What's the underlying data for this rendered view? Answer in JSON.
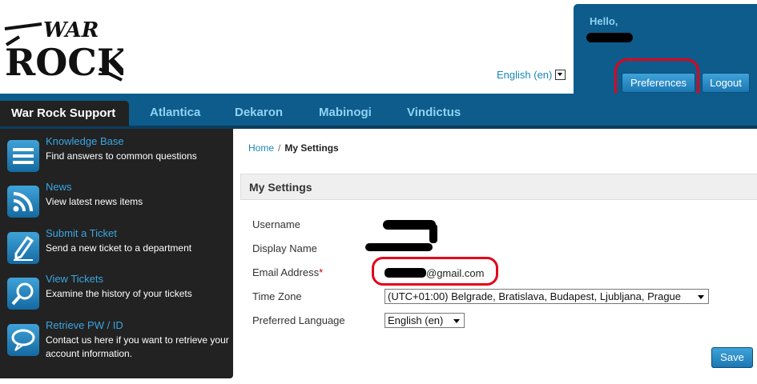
{
  "brand": {
    "logo_text_top": "WAR",
    "logo_text_bottom": "ROCK"
  },
  "header": {
    "language": "English (en)",
    "hello": "Hello,",
    "preferences_label": "Preferences",
    "logout_label": "Logout"
  },
  "nav": {
    "active": "War Rock Support",
    "tabs": [
      "Atlantica",
      "Dekaron",
      "Mabinogi",
      "Vindictus"
    ]
  },
  "sidebar": {
    "items": [
      {
        "title": "Knowledge Base",
        "desc": "Find answers to common questions",
        "icon": "list-icon"
      },
      {
        "title": "News",
        "desc": "View latest news items",
        "icon": "rss-icon"
      },
      {
        "title": "Submit a Ticket",
        "desc": "Send a new ticket to a department",
        "icon": "pencil-icon"
      },
      {
        "title": "View Tickets",
        "desc": "Examine the history of your tickets",
        "icon": "magnifier-icon"
      },
      {
        "title": "Retrieve PW / ID",
        "desc": "Contact us here if you want to retrieve your account information.",
        "icon": "speech-bubble-icon"
      }
    ]
  },
  "breadcrumb": {
    "home": "Home",
    "separator": "/",
    "current": "My Settings"
  },
  "settings": {
    "heading": "My Settings",
    "labels": {
      "username": "Username",
      "display_name": "Display Name",
      "email": "Email Address",
      "required_mark": "*",
      "timezone": "Time Zone",
      "language": "Preferred Language"
    },
    "email_suffix": "@gmail.com",
    "timezone_value": "(UTC+01:00) Belgrade, Bratislava, Budapest, Ljubljana, Prague",
    "language_value": "English (en)",
    "save_label": "Save"
  },
  "colors": {
    "nav_bg": "#0d5c8b",
    "sidebar_bg": "#222222",
    "link": "#1a87b8",
    "annotation_red": "#e3001b"
  }
}
